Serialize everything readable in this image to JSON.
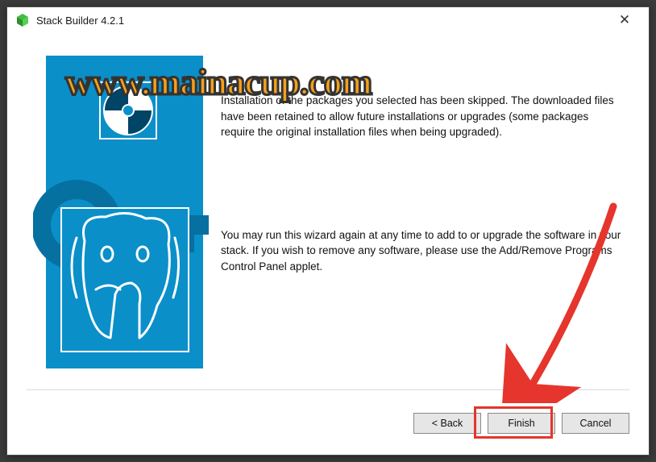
{
  "titlebar": {
    "title": "Stack Builder 4.2.1",
    "close_glyph": "✕"
  },
  "content": {
    "paragraph1": "Installation of the packages you selected has been skipped. The downloaded files have been retained to allow future installations or upgrades (some packages require the original installation files when being upgraded).",
    "paragraph2": "You may run this wizard again at any time to add to or upgrade the software in your stack. If you wish to remove any software, please use the Add/Remove Programs Control Panel applet."
  },
  "buttons": {
    "back": "< Back",
    "finish": "Finish",
    "cancel": "Cancel"
  },
  "watermark": "www.mainacup.com"
}
